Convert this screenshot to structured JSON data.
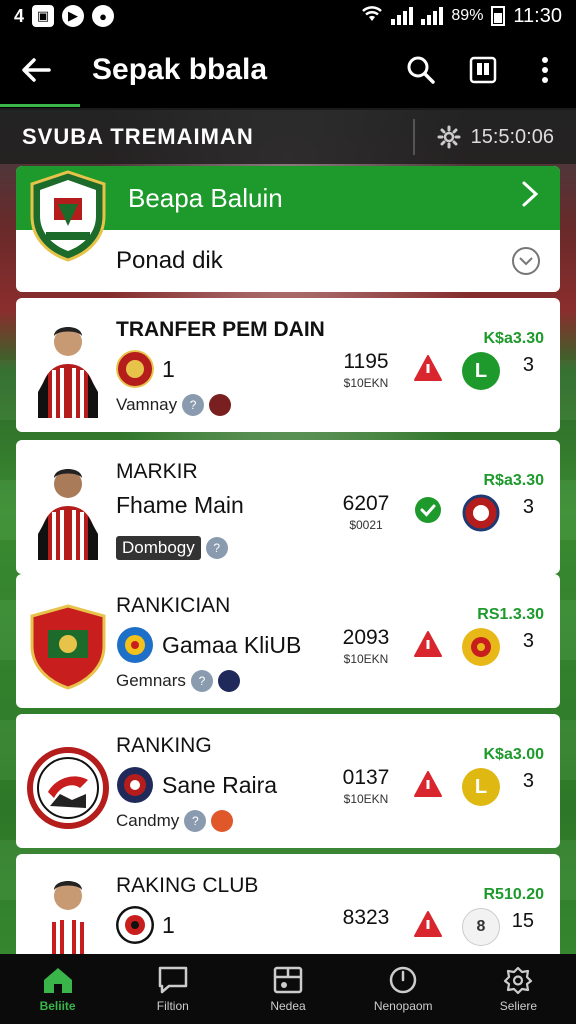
{
  "status_bar": {
    "left_text": "4",
    "battery_text": "89%",
    "time": "11:30"
  },
  "app_bar": {
    "title": "Sepak bbala"
  },
  "sub_header": {
    "title": "SVUBA TREMAIMAN",
    "clock": "15:5:0:06"
  },
  "featured": {
    "title": "Beapa Baluin",
    "subtitle": "Ponad dik"
  },
  "cards": [
    {
      "name": "TRANFER PEM DAIN",
      "club": "1",
      "meta": "Vamnay",
      "number": "1195",
      "sub_number": "$10EKN",
      "price": "K$a3.30",
      "rank": "3",
      "badge_color": "#1e9a2c",
      "badge_glyph": "L"
    },
    {
      "name": "MARKIR",
      "club": "Fhame Main",
      "meta": "Dombogy",
      "number": "6207",
      "sub_number": "$0021",
      "price": "R$a3.30",
      "rank": "3",
      "badge_color": "#b22222",
      "badge_glyph": ""
    },
    {
      "name": "RANKICIAN",
      "club": "Gamaa KliUB",
      "meta": "Gemnars",
      "number": "2093",
      "sub_number": "$10EKN",
      "price": "RS1.3.30",
      "rank": "3",
      "badge_color": "#e8b818",
      "badge_glyph": ""
    },
    {
      "name": "RANKING",
      "club": "Sane Raira",
      "meta": "Candmy",
      "number": "0137",
      "sub_number": "$10EKN",
      "price": "K$a3.00",
      "rank": "3",
      "badge_color": "#e0b812",
      "badge_glyph": "L"
    },
    {
      "name": "RAKING CLUB",
      "club": "1",
      "meta": "",
      "number": "8323",
      "sub_number": "",
      "price": "R510.20",
      "rank": "15",
      "badge_color": "#f2f2f2",
      "badge_glyph": "8"
    }
  ],
  "bottom_nav": [
    {
      "label": "Beliite",
      "icon": "home-icon",
      "active": true
    },
    {
      "label": "Filtion",
      "icon": "chat-icon",
      "active": false
    },
    {
      "label": "Nedea",
      "icon": "media-icon",
      "active": false
    },
    {
      "label": "Nenopaom",
      "icon": "clock-icon",
      "active": false
    },
    {
      "label": "Seliere",
      "icon": "settings-icon",
      "active": false
    }
  ],
  "colors": {
    "accent": "#1e9a2c",
    "warning": "#d9262e",
    "appbar": "#000000"
  }
}
